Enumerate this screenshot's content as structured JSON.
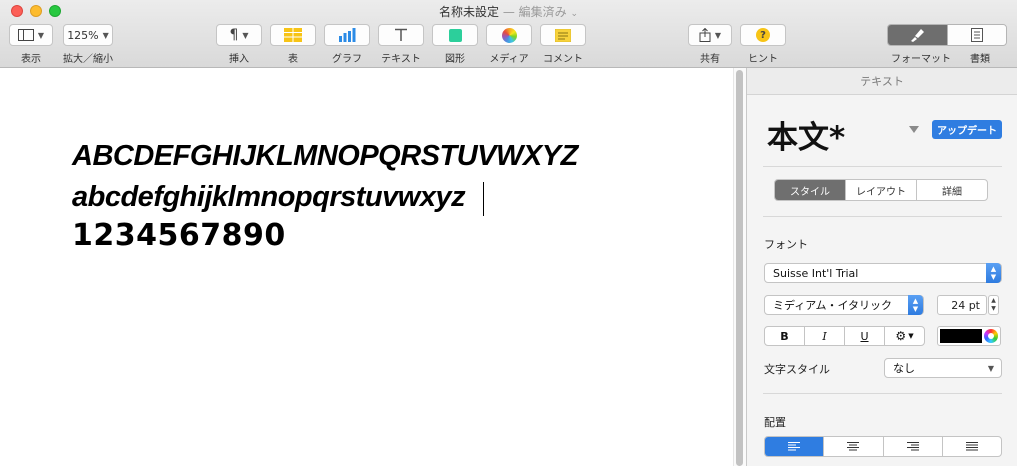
{
  "window": {
    "title": "名称未設定",
    "status": "— 編集済み"
  },
  "toolbar": {
    "view_label": "表示",
    "zoom_value": "125%",
    "zoom_label": "拡大／縮小",
    "insert_label": "挿入",
    "table_label": "表",
    "chart_label": "グラフ",
    "text_label": "テキスト",
    "shape_label": "図形",
    "media_label": "メディア",
    "comment_label": "コメント",
    "share_label": "共有",
    "tips_label": "ヒント",
    "format_label": "フォーマット",
    "document_label": "書類"
  },
  "document": {
    "line1": "ABCDEFGHIJKLMNOPQRSTUVWXYZ",
    "line2": "abcdefghijklmnopqrstuvwxyz",
    "line3": "1234567890"
  },
  "inspector": {
    "header": "テキスト",
    "paragraph_style": "本文*",
    "update_button": "アップデート",
    "tabs": [
      "スタイル",
      "レイアウト",
      "詳細"
    ],
    "font_section": "フォント",
    "font_family": "Suisse Int'l Trial",
    "font_typeface": "ミディアム・イタリック",
    "font_size": "24 pt",
    "bold": "B",
    "italic": "I",
    "underline": "U",
    "text_color": "#000000",
    "char_style_label": "文字スタイル",
    "char_style_value": "なし",
    "alignment_section": "配置"
  }
}
